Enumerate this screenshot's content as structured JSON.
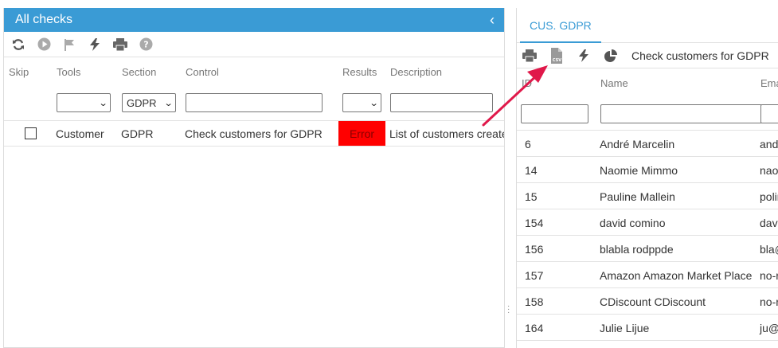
{
  "left": {
    "title": "All checks",
    "collapse_glyph": "‹",
    "toolbar": [
      "refresh-icon",
      "play-icon",
      "flag-icon",
      "bolt-icon",
      "print-icon",
      "help-icon"
    ],
    "columns": {
      "skip": "Skip",
      "tools": "Tools",
      "section": "Section",
      "control": "Control",
      "results": "Results",
      "description": "Description"
    },
    "filters": {
      "tools": "",
      "section": "GDPR",
      "control": "",
      "results": "",
      "description": ""
    },
    "rows": [
      {
        "skip": false,
        "tools": "Customer",
        "section": "GDPR",
        "control": "Check customers for GDPR",
        "result": "Error",
        "description": "List of customers create"
      }
    ]
  },
  "right": {
    "tab": "CUS. GDPR",
    "toolbar": [
      "print-icon",
      "csv-file-icon",
      "bolt-icon",
      "pie-chart-icon"
    ],
    "toolbar_title": "Check customers for GDPR",
    "columns": {
      "id": "ID",
      "name": "Name",
      "email": "Ema"
    },
    "rows": [
      {
        "id": "6",
        "name": "André Marcelin",
        "email": "and"
      },
      {
        "id": "14",
        "name": "Naomie Mimmo",
        "email": "nao"
      },
      {
        "id": "15",
        "name": "Pauline Mallein",
        "email": "polin"
      },
      {
        "id": "154",
        "name": "david comino",
        "email": "davi"
      },
      {
        "id": "156",
        "name": "blabla rodppde",
        "email": "bla@"
      },
      {
        "id": "157",
        "name": "Amazon Amazon Market Place",
        "email": "no-r"
      },
      {
        "id": "158",
        "name": "CDiscount CDiscount",
        "email": "no-r"
      },
      {
        "id": "164",
        "name": "Julie Lijue",
        "email": "ju@"
      }
    ]
  },
  "colors": {
    "accent": "#3a9bd5",
    "error": "#ff0000",
    "arrow": "#e0184a"
  }
}
